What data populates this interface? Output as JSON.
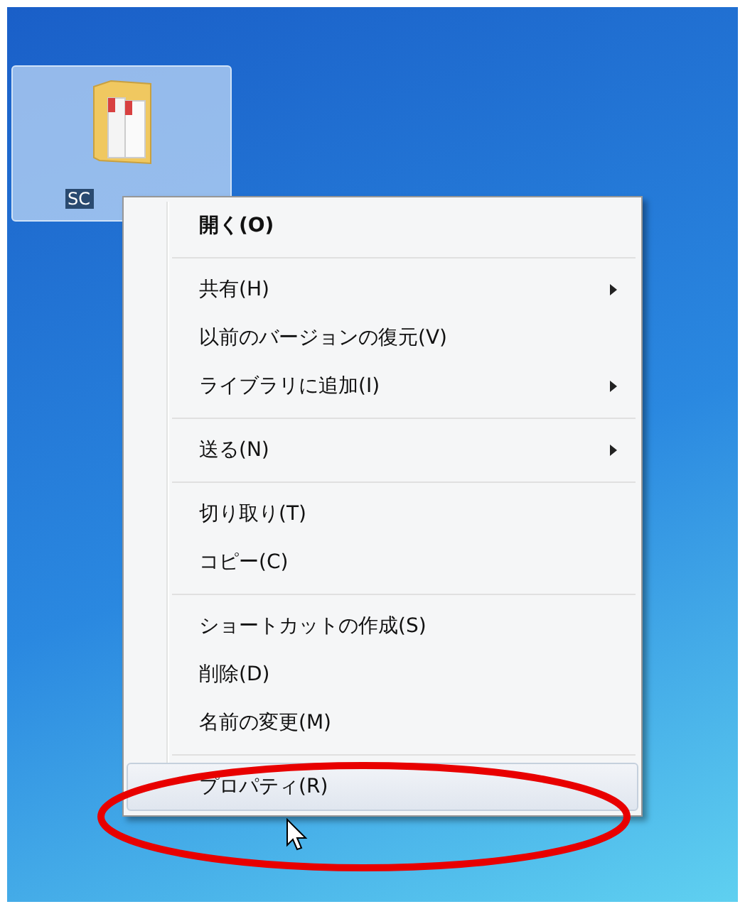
{
  "desktop_icon": {
    "label": "SC",
    "selected": true
  },
  "context_menu": {
    "groups": [
      [
        {
          "label": "開く(O)",
          "default": true,
          "submenu": false,
          "selected": false
        }
      ],
      [
        {
          "label": "共有(H)",
          "default": false,
          "submenu": true,
          "selected": false
        },
        {
          "label": "以前のバージョンの復元(V)",
          "default": false,
          "submenu": false,
          "selected": false
        },
        {
          "label": "ライブラリに追加(I)",
          "default": false,
          "submenu": true,
          "selected": false
        }
      ],
      [
        {
          "label": "送る(N)",
          "default": false,
          "submenu": true,
          "selected": false
        }
      ],
      [
        {
          "label": "切り取り(T)",
          "default": false,
          "submenu": false,
          "selected": false
        },
        {
          "label": "コピー(C)",
          "default": false,
          "submenu": false,
          "selected": false
        }
      ],
      [
        {
          "label": "ショートカットの作成(S)",
          "default": false,
          "submenu": false,
          "selected": false
        },
        {
          "label": "削除(D)",
          "default": false,
          "submenu": false,
          "selected": false
        },
        {
          "label": "名前の変更(M)",
          "default": false,
          "submenu": false,
          "selected": false
        }
      ],
      [
        {
          "label": "プロパティ(R)",
          "default": false,
          "submenu": false,
          "selected": true
        }
      ]
    ]
  }
}
